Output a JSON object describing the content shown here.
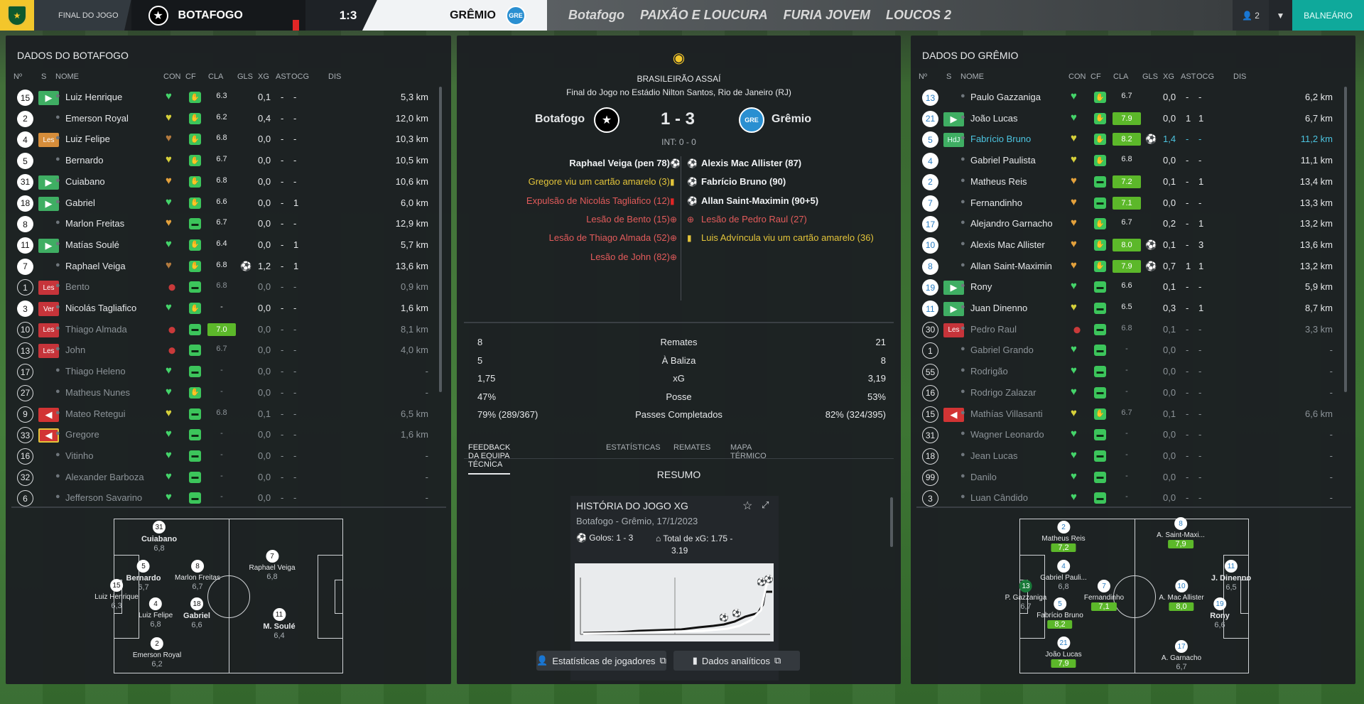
{
  "topbar": {
    "final_label": "FINAL DO JOGO",
    "home": "BOTAFOGO",
    "score": "1:3",
    "away": "GRÊMIO",
    "user_count": "2",
    "balneario": "BALNEÁRIO",
    "banners": [
      "Botafogo",
      "PAIXÃO E LOUCURA",
      "FURIA JOVEM",
      "LOUCOS 2"
    ]
  },
  "home": {
    "title": "DADOS DO BOTAFOGO",
    "headers": [
      "Nº",
      "S",
      "NOME",
      "CON",
      "CF",
      "CLA",
      "GLS",
      "XG",
      "AST",
      "OCG",
      "DIS"
    ],
    "players": [
      {
        "n": "15",
        "s": "in",
        "name": "Luiz Henrique",
        "con": "g",
        "cla": "6.3",
        "gls": "",
        "xg": "0,1",
        "ast": "-",
        "ocg": "-",
        "dis": "5,3 km"
      },
      {
        "n": "2",
        "s": "",
        "name": "Emerson Royal",
        "con": "y",
        "cla": "6.2",
        "gls": "",
        "xg": "0,4",
        "ast": "-",
        "ocg": "-",
        "dis": "12,0 km"
      },
      {
        "n": "4",
        "s": "lesy",
        "name": "Luiz Felipe",
        "con": "b",
        "cla": "6.8",
        "gls": "",
        "xg": "0,0",
        "ast": "-",
        "ocg": "-",
        "dis": "10,3 km"
      },
      {
        "n": "5",
        "s": "",
        "name": "Bernardo",
        "con": "y",
        "cla": "6.7",
        "gls": "",
        "xg": "0,0",
        "ast": "-",
        "ocg": "-",
        "dis": "10,5 km"
      },
      {
        "n": "31",
        "s": "in",
        "name": "Cuiabano",
        "con": "o",
        "cla": "6.8",
        "gls": "",
        "xg": "0,0",
        "ast": "-",
        "ocg": "-",
        "dis": "10,6 km"
      },
      {
        "n": "18",
        "s": "in",
        "name": "Gabriel",
        "con": "g",
        "cla": "6.6",
        "gls": "",
        "xg": "0,0",
        "ast": "-",
        "ocg": "1",
        "dis": "6,0 km"
      },
      {
        "n": "8",
        "s": "",
        "name": "Marlon Freitas",
        "con": "o",
        "cla": "6.7",
        "gls": "",
        "xg": "0,0",
        "ast": "-",
        "ocg": "-",
        "dis": "12,9 km"
      },
      {
        "n": "11",
        "s": "in",
        "name": "Matías Soulé",
        "con": "g",
        "cla": "6.4",
        "gls": "",
        "xg": "0,0",
        "ast": "-",
        "ocg": "1",
        "dis": "5,7 km"
      },
      {
        "n": "7",
        "s": "",
        "name": "Raphael Veiga",
        "con": "b",
        "cla": "6.8",
        "gls": "⚽",
        "xg": "1,2",
        "ast": "-",
        "ocg": "1",
        "dis": "13,6 km"
      },
      {
        "n": "1",
        "s": "les",
        "name": "Bento",
        "con": "inj",
        "cla": "6.8",
        "gls": "",
        "xg": "0,0",
        "ast": "-",
        "ocg": "-",
        "dis": "0,9 km",
        "dim": true
      },
      {
        "n": "3",
        "s": "ver",
        "name": "Nicolás Tagliafico",
        "con": "g",
        "cla": "-",
        "gls": "",
        "xg": "0,0",
        "ast": "-",
        "ocg": "-",
        "dis": "1,6 km"
      },
      {
        "n": "10",
        "s": "les",
        "name": "Thiago Almada",
        "con": "inj",
        "cla": "7.0",
        "hi": true,
        "gls": "",
        "xg": "0,0",
        "ast": "-",
        "ocg": "-",
        "dis": "8,1 km",
        "dim": true
      },
      {
        "n": "13",
        "s": "les",
        "name": "John",
        "con": "inj",
        "cla": "6.7",
        "gls": "",
        "xg": "0,0",
        "ast": "-",
        "ocg": "-",
        "dis": "4,0 km",
        "dim": true
      },
      {
        "n": "17",
        "s": "",
        "name": "Thiago Heleno",
        "con": "g",
        "cla": "-",
        "gls": "",
        "xg": "0,0",
        "ast": "-",
        "ocg": "-",
        "dis": "-",
        "dim": true
      },
      {
        "n": "27",
        "s": "",
        "name": "Matheus Nunes",
        "con": "g",
        "cla": "-",
        "gls": "",
        "xg": "0,0",
        "ast": "-",
        "ocg": "-",
        "dis": "-",
        "dim": true
      },
      {
        "n": "9",
        "s": "out",
        "name": "Mateo Retegui",
        "con": "y",
        "cla": "6.8",
        "gls": "",
        "xg": "0,1",
        "ast": "-",
        "ocg": "-",
        "dis": "6,5 km",
        "dim": true
      },
      {
        "n": "33",
        "s": "outy",
        "name": "Gregore",
        "con": "g",
        "cla": "-",
        "gls": "",
        "xg": "0,0",
        "ast": "-",
        "ocg": "-",
        "dis": "1,6 km",
        "dim": true
      },
      {
        "n": "16",
        "s": "",
        "name": "Vitinho",
        "con": "g",
        "cla": "-",
        "gls": "",
        "xg": "0,0",
        "ast": "-",
        "ocg": "-",
        "dis": "-",
        "dim": true
      },
      {
        "n": "32",
        "s": "",
        "name": "Alexander Barboza",
        "con": "g",
        "cla": "-",
        "gls": "",
        "xg": "0,0",
        "ast": "-",
        "ocg": "-",
        "dis": "-",
        "dim": true
      },
      {
        "n": "6",
        "s": "",
        "name": "Jefferson Savarino",
        "con": "g",
        "cla": "-",
        "gls": "",
        "xg": "0,0",
        "ast": "-",
        "ocg": "-",
        "dis": "-",
        "dim": true
      }
    ],
    "pitch": [
      {
        "n": "31",
        "name": "Cuiabano",
        "r": "6,8"
      },
      {
        "n": "5",
        "name": "Bernardo",
        "r": "6,7"
      },
      {
        "n": "8",
        "name": "Marlon Freitas",
        "r": "6,7"
      },
      {
        "n": "7",
        "name": "Raphael Veiga",
        "r": "6,8"
      },
      {
        "n": "15",
        "name": "Luiz Henrique",
        "r": "6,3"
      },
      {
        "n": "4",
        "name": "Luiz Felipe",
        "r": "6,8"
      },
      {
        "n": "18",
        "name": "Gabriel",
        "r": "6,6"
      },
      {
        "n": "11",
        "name": "M. Soulé",
        "r": "6,4"
      },
      {
        "n": "2",
        "name": "Emerson Royal",
        "r": "6,2"
      }
    ]
  },
  "away": {
    "title": "DADOS DO GRÊMIO",
    "players": [
      {
        "n": "13",
        "s": "",
        "name": "Paulo Gazzaniga",
        "con": "g",
        "cf": "m",
        "cla": "6.7",
        "gls": "",
        "xg": "0,0",
        "ast": "-",
        "ocg": "-",
        "dis": "6,2 km"
      },
      {
        "n": "21",
        "s": "in",
        "name": "João Lucas",
        "con": "g",
        "cf": "m",
        "cla": "7.9",
        "hi": true,
        "gls": "",
        "xg": "0,0",
        "ast": "1",
        "ocg": "1",
        "dis": "6,7 km"
      },
      {
        "n": "5",
        "s": "hdj",
        "name": "Fabrício Bruno",
        "con": "y",
        "cf": "m",
        "cla": "8.2",
        "hi": true,
        "gls": "⚽",
        "xg": "1,4",
        "ast": "-",
        "ocg": "-",
        "dis": "11,2 km",
        "cyan": true
      },
      {
        "n": "4",
        "s": "",
        "name": "Gabriel Paulista",
        "con": "y",
        "cf": "m",
        "cla": "6.8",
        "gls": "",
        "xg": "0,0",
        "ast": "-",
        "ocg": "-",
        "dis": "11,1 km"
      },
      {
        "n": "2",
        "s": "",
        "name": "Matheus Reis",
        "con": "o",
        "cf": "n",
        "cla": "7.2",
        "hi": true,
        "gls": "",
        "xg": "0,1",
        "ast": "-",
        "ocg": "1",
        "dis": "13,4 km"
      },
      {
        "n": "7",
        "s": "",
        "name": "Fernandinho",
        "con": "o",
        "cf": "n",
        "cla": "7.1",
        "hi": true,
        "gls": "",
        "xg": "0,0",
        "ast": "-",
        "ocg": "-",
        "dis": "13,3 km"
      },
      {
        "n": "17",
        "s": "",
        "name": "Alejandro Garnacho",
        "con": "o",
        "cf": "m",
        "cla": "6.7",
        "gls": "",
        "xg": "0,2",
        "ast": "-",
        "ocg": "1",
        "dis": "13,2 km"
      },
      {
        "n": "10",
        "s": "",
        "name": "Alexis Mac Allister",
        "con": "o",
        "cf": "m",
        "cla": "8.0",
        "hi": true,
        "gls": "⚽",
        "xg": "0,1",
        "ast": "-",
        "ocg": "3",
        "dis": "13,6 km"
      },
      {
        "n": "8",
        "s": "",
        "name": "Allan Saint-Maximin",
        "con": "o",
        "cf": "m",
        "cla": "7.9",
        "hi": true,
        "gls": "⚽",
        "xg": "0,7",
        "ast": "1",
        "ocg": "1",
        "dis": "13,2 km"
      },
      {
        "n": "19",
        "s": "in",
        "name": "Rony",
        "con": "g",
        "cf": "n",
        "cla": "6.6",
        "gls": "",
        "xg": "0,1",
        "ast": "-",
        "ocg": "-",
        "dis": "5,9 km"
      },
      {
        "n": "11",
        "s": "in",
        "name": "Juan Dinenno",
        "con": "y",
        "cf": "n",
        "cla": "6.5",
        "gls": "",
        "xg": "0,3",
        "ast": "-",
        "ocg": "1",
        "dis": "8,7 km"
      },
      {
        "n": "30",
        "s": "les",
        "name": "Pedro Raul",
        "con": "inj",
        "cf": "n",
        "cla": "6.8",
        "gls": "",
        "xg": "0,1",
        "ast": "-",
        "ocg": "-",
        "dis": "3,3 km",
        "dim": true
      },
      {
        "n": "1",
        "s": "",
        "name": "Gabriel Grando",
        "con": "g",
        "cf": "n",
        "cla": "-",
        "gls": "",
        "xg": "0,0",
        "ast": "-",
        "ocg": "-",
        "dis": "-",
        "dim": true
      },
      {
        "n": "55",
        "s": "",
        "name": "Rodrigão",
        "con": "g",
        "cf": "n",
        "cla": "-",
        "gls": "",
        "xg": "0,0",
        "ast": "-",
        "ocg": "-",
        "dis": "-",
        "dim": true
      },
      {
        "n": "16",
        "s": "",
        "name": "Rodrigo Zalazar",
        "con": "g",
        "cf": "n",
        "cla": "-",
        "gls": "",
        "xg": "0,0",
        "ast": "-",
        "ocg": "-",
        "dis": "-",
        "dim": true
      },
      {
        "n": "15",
        "s": "out",
        "name": "Mathías Villasanti",
        "con": "y",
        "cf": "m",
        "cla": "6.7",
        "gls": "",
        "xg": "0,1",
        "ast": "-",
        "ocg": "-",
        "dis": "6,6 km",
        "dim": true
      },
      {
        "n": "31",
        "s": "",
        "name": "Wagner Leonardo",
        "con": "g",
        "cf": "n",
        "cla": "-",
        "gls": "",
        "xg": "0,0",
        "ast": "-",
        "ocg": "-",
        "dis": "-",
        "dim": true
      },
      {
        "n": "18",
        "s": "",
        "name": "Jean Lucas",
        "con": "g",
        "cf": "n",
        "cla": "-",
        "gls": "",
        "xg": "0,0",
        "ast": "-",
        "ocg": "-",
        "dis": "-",
        "dim": true
      },
      {
        "n": "99",
        "s": "",
        "name": "Danilo",
        "con": "g",
        "cf": "n",
        "cla": "-",
        "gls": "",
        "xg": "0,0",
        "ast": "-",
        "ocg": "-",
        "dis": "-",
        "dim": true
      },
      {
        "n": "3",
        "s": "",
        "name": "Luan Cândido",
        "con": "g",
        "cf": "n",
        "cla": "-",
        "gls": "",
        "xg": "0,0",
        "ast": "-",
        "ocg": "-",
        "dis": "-",
        "dim": true
      }
    ],
    "pitch": [
      {
        "n": "2",
        "name": "Matheus Reis",
        "r": "7,2",
        "hi": true
      },
      {
        "n": "8",
        "name": "A. Saint-Maxi...",
        "r": "7,9",
        "hi": true
      },
      {
        "n": "4",
        "name": "Gabriel Pauli...",
        "r": "6,8"
      },
      {
        "n": "7",
        "name": "Fernandinho",
        "r": "7,1",
        "hi": true
      },
      {
        "n": "10",
        "name": "A. Mac Allister",
        "r": "8,0",
        "hi": true
      },
      {
        "n": "11",
        "name": "J. Dinenno",
        "r": "6,5"
      },
      {
        "n": "13",
        "name": "P. Gazzaniga",
        "r": "6,7",
        "gk": true
      },
      {
        "n": "5",
        "name": "Fabrício Bruno",
        "r": "8,2",
        "hi": true
      },
      {
        "n": "19",
        "name": "Rony",
        "r": "6,6"
      },
      {
        "n": "21",
        "name": "João Lucas",
        "r": "7,9",
        "hi": true
      },
      {
        "n": "17",
        "name": "A. Garnacho",
        "r": "6,7"
      }
    ]
  },
  "match": {
    "competition": "BRASILEIRÃO ASSAÍ",
    "venue": "Final do Jogo no Estádio Nilton Santos, Rio de Janeiro (RJ)",
    "home": "Botafogo",
    "away": "Grêmio",
    "score": "1 - 3",
    "ht": "INT: 0 - 0",
    "home_events": [
      {
        "t": "Raphael Veiga (pen 78)",
        "k": "goal"
      },
      {
        "t": "Gregore viu um cartão amarelo (3)",
        "k": "yellow"
      },
      {
        "t": "Expulsão de Nicolás Tagliafico (12)",
        "k": "red"
      },
      {
        "t": "Lesão de Bento (15)",
        "k": "inj"
      },
      {
        "t": "Lesão de Thiago Almada (52)",
        "k": "inj"
      },
      {
        "t": "Lesão de John (82)",
        "k": "inj"
      }
    ],
    "away_events": [
      {
        "t": "Alexis Mac Allister (87)",
        "k": "goal"
      },
      {
        "t": "Fabrício Bruno (90)",
        "k": "goal"
      },
      {
        "t": "Allan Saint-Maximin (90+5)",
        "k": "goal"
      },
      {
        "t": "Lesão de Pedro Raul (27)",
        "k": "inj"
      },
      {
        "t": "Luis Advíncula viu um cartão amarelo (36)",
        "k": "yellow"
      }
    ],
    "stats": [
      {
        "h": "8",
        "l": "Remates",
        "a": "21"
      },
      {
        "h": "5",
        "l": "À Baliza",
        "a": "8"
      },
      {
        "h": "1,75",
        "l": "xG",
        "a": "3,19"
      },
      {
        "h": "47%",
        "l": "Posse",
        "a": "53%"
      },
      {
        "h": "79% (289/367)",
        "l": "Passes Completados",
        "a": "82% (324/395)"
      }
    ],
    "tabs": [
      "FEEDBACK DA EQUIPA TÉCNICA",
      "ESTATÍSTICAS",
      "REMATES",
      "MAPA TÉRMICO"
    ],
    "resumo": "RESUMO",
    "xg_title": "HISTÓRIA DO JOGO XG",
    "xg_sub": "Botafogo - Grêmio, 17/1/2023",
    "xg_goals": "Golos: 1 - 3",
    "xg_total": "Total de xG: 1.75 -",
    "xg_total2": "3.19",
    "btn_players": "Estatísticas de jogadores",
    "btn_analytics": "Dados analíticos"
  }
}
